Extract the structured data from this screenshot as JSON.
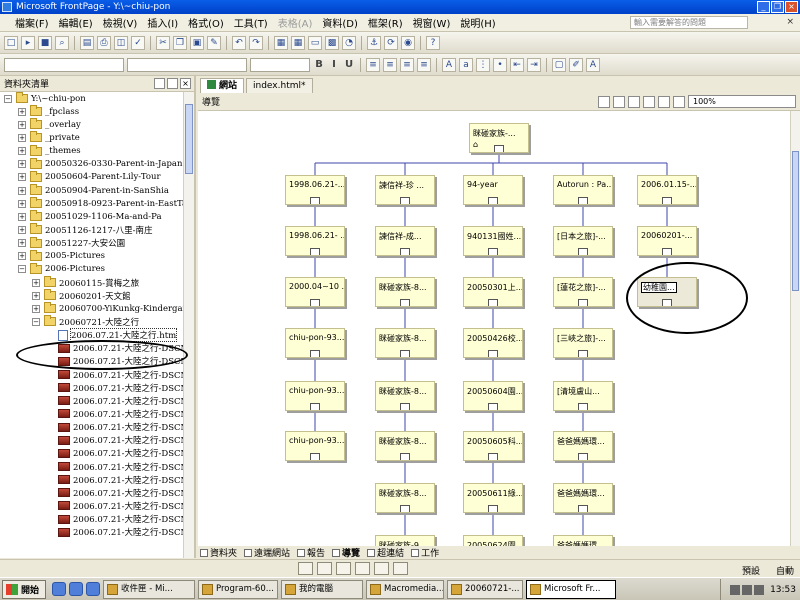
{
  "window": {
    "title": "Microsoft FrontPage - Y:\\~chiu-pon",
    "min": "_",
    "restore": "❐",
    "close": "×"
  },
  "menu": {
    "items": [
      {
        "label": "檔案(F)",
        "disabled": false
      },
      {
        "label": "編輯(E)",
        "disabled": false
      },
      {
        "label": "檢視(V)",
        "disabled": false
      },
      {
        "label": "插入(I)",
        "disabled": false
      },
      {
        "label": "格式(O)",
        "disabled": false
      },
      {
        "label": "工具(T)",
        "disabled": false
      },
      {
        "label": "表格(A)",
        "disabled": true
      },
      {
        "label": "資料(D)",
        "disabled": false
      },
      {
        "label": "框架(R)",
        "disabled": false
      },
      {
        "label": "視窗(W)",
        "disabled": false
      },
      {
        "label": "說明(H)",
        "disabled": false
      }
    ],
    "ask_placeholder": "輸入需要解答的問題",
    "close_doc": "×"
  },
  "folder_panel": {
    "title": "資料夾清單",
    "rows": [
      {
        "label": "Y:\\~chiu-pon",
        "type": "folder",
        "indent": 0,
        "expander": "-"
      },
      {
        "label": "_fpclass",
        "type": "folder",
        "indent": 1,
        "expander": "+"
      },
      {
        "label": "_overlay",
        "type": "folder",
        "indent": 1,
        "expander": "+"
      },
      {
        "label": "_private",
        "type": "folder",
        "indent": 1,
        "expander": "+"
      },
      {
        "label": "_themes",
        "type": "folder",
        "indent": 1,
        "expander": "+"
      },
      {
        "label": "20050326-0330-Parent-in-Japan",
        "type": "folder",
        "indent": 1,
        "expander": "+"
      },
      {
        "label": "20050604-Parent-Lily-Tour",
        "type": "folder",
        "indent": 1,
        "expander": "+"
      },
      {
        "label": "20050904-Parent-in-SanShia",
        "type": "folder",
        "indent": 1,
        "expander": "+"
      },
      {
        "label": "20050918-0923-Parent-in-EastTaiwan",
        "type": "folder",
        "indent": 1,
        "expander": "+"
      },
      {
        "label": "20051029-1106-Ma-and-Pa",
        "type": "folder",
        "indent": 1,
        "expander": "+"
      },
      {
        "label": "20051126-1217-八里-南庄",
        "type": "folder",
        "indent": 1,
        "expander": "+"
      },
      {
        "label": "20051227-大安公園",
        "type": "folder",
        "indent": 1,
        "expander": "+"
      },
      {
        "label": "2005-Pictures",
        "type": "folder",
        "indent": 1,
        "expander": "+"
      },
      {
        "label": "2006-Pictures",
        "type": "folder",
        "indent": 1,
        "expander": "-"
      },
      {
        "label": "20060115-賞梅之旅",
        "type": "folder",
        "indent": 2,
        "expander": "+"
      },
      {
        "label": "20060201-天文館",
        "type": "folder",
        "indent": 2,
        "expander": "+"
      },
      {
        "label": "20060700-YiKunkg-Kindergarten-i",
        "type": "folder",
        "indent": 2,
        "expander": "+"
      },
      {
        "label": "20060721-大陸之行",
        "type": "folder",
        "indent": 2,
        "expander": "-"
      },
      {
        "label": "2006.07.21-大陸之行.htm",
        "type": "page",
        "indent": 3,
        "expander": "",
        "selected": true
      },
      {
        "label": "2006.07.21-大陸之行-DSCN40",
        "type": "image",
        "indent": 3,
        "expander": ""
      },
      {
        "label": "2006.07.21-大陸之行-DSCN40",
        "type": "image",
        "indent": 3,
        "expander": ""
      },
      {
        "label": "2006.07.21-大陸之行-DSCN40",
        "type": "image",
        "indent": 3,
        "expander": ""
      },
      {
        "label": "2006.07.21-大陸之行-DSCN40",
        "type": "image",
        "indent": 3,
        "expander": ""
      },
      {
        "label": "2006.07.21-大陸之行-DSCN40",
        "type": "image",
        "indent": 3,
        "expander": ""
      },
      {
        "label": "2006.07.21-大陸之行-DSCN40",
        "type": "image",
        "indent": 3,
        "expander": ""
      },
      {
        "label": "2006.07.21-大陸之行-DSCN40",
        "type": "image",
        "indent": 3,
        "expander": ""
      },
      {
        "label": "2006.07.21-大陸之行-DSCN40",
        "type": "image",
        "indent": 3,
        "expander": ""
      },
      {
        "label": "2006.07.21-大陸之行-DSCN40",
        "type": "image",
        "indent": 3,
        "expander": ""
      },
      {
        "label": "2006.07.21-大陸之行-DSCN40",
        "type": "image",
        "indent": 3,
        "expander": ""
      },
      {
        "label": "2006.07.21-大陸之行-DSCN40",
        "type": "image",
        "indent": 3,
        "expander": ""
      },
      {
        "label": "2006.07.21-大陸之行-DSCN40",
        "type": "image",
        "indent": 3,
        "expander": ""
      },
      {
        "label": "2006.07.21-大陸之行-DSCN40",
        "type": "image",
        "indent": 3,
        "expander": ""
      },
      {
        "label": "2006.07.21-大陸之行-DSCN40",
        "type": "image",
        "indent": 3,
        "expander": ""
      },
      {
        "label": "2006.07.21-大陸之行-DSCN40",
        "type": "image",
        "indent": 3,
        "expander": ""
      }
    ]
  },
  "tabs": [
    {
      "label": "網站",
      "active": true
    },
    {
      "label": "index.html*",
      "active": false
    }
  ],
  "nav_view": {
    "title": "導覽",
    "zoom": "100%"
  },
  "navigation": {
    "root": "眯碰家族-...",
    "columns": [
      [
        "1998.06.21-...",
        "1998.06.21- ...",
        "2000.04~10 ...",
        "chiu-pon-93...",
        "chiu-pon-93...",
        "chiu-pon-93..."
      ],
      [
        "諫信祥-珍 ...",
        "諫信祥-成...",
        "眯碰家族-8...",
        "眯碰家族-8...",
        "眯碰家族-8...",
        "眯碰家族-8...",
        "眯碰家族-8...",
        "眯碰家族-9..."
      ],
      [
        "94-year",
        "940131國姓...",
        "20050301上...",
        "20050426校...",
        "20050604園...",
        "20050605科...",
        "20050611綠...",
        "20050624園..."
      ],
      [
        "Autorun : Pa...",
        "[日本之旅]-...",
        "[蓮花之旅]-...",
        "[三峽之旅]-...",
        "[清境盧山...",
        "爸爸媽媽環...",
        "爸爸媽媽環...",
        "爸爸媽媽環..."
      ],
      [
        "2006.01.15-...",
        "20060201-...",
        "幼稚園..."
      ]
    ]
  },
  "view_bar": [
    {
      "label": "資料夾",
      "active": false
    },
    {
      "label": "遠端網站",
      "active": false
    },
    {
      "label": "報告",
      "active": false
    },
    {
      "label": "導覽",
      "active": true
    },
    {
      "label": "超連結",
      "active": false
    },
    {
      "label": "工作",
      "active": false
    }
  ],
  "status": {
    "default": "預設",
    "ratio": "自動"
  },
  "taskbar": {
    "start": "開始",
    "items": [
      {
        "label": "收件匣 - Mi...",
        "active": false
      },
      {
        "label": "Program-60...",
        "active": false
      },
      {
        "label": "我的電腦",
        "active": false
      },
      {
        "label": "Macromedia...",
        "active": false
      },
      {
        "label": "20060721-...",
        "active": false
      },
      {
        "label": "Microsoft Fr...",
        "active": true
      }
    ],
    "clock": "13:53"
  }
}
